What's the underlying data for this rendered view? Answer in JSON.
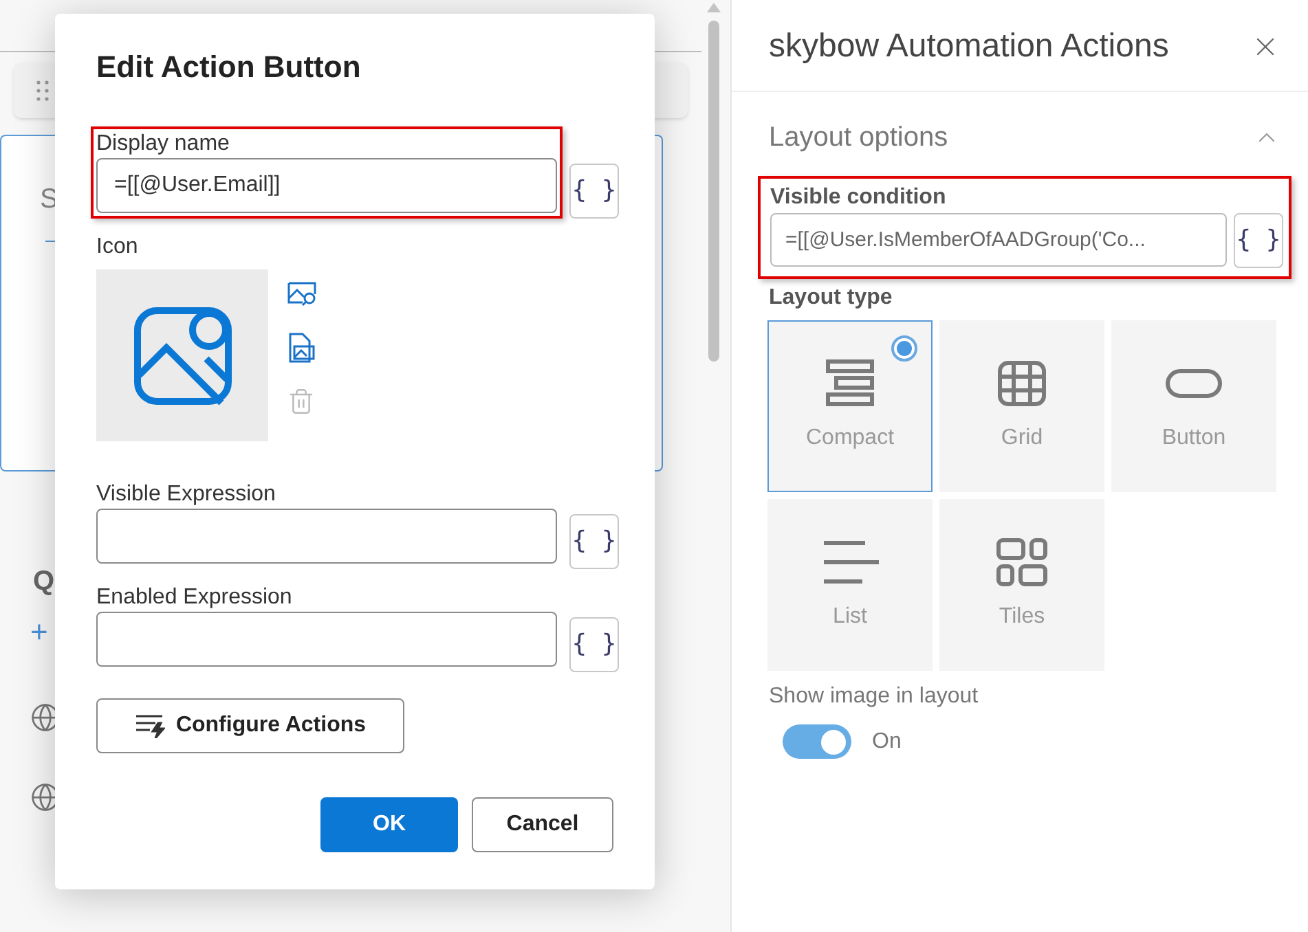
{
  "background": {
    "card_letter": "S",
    "section_letter": "Q",
    "add_sign": "+"
  },
  "dialog": {
    "title": "Edit Action Button",
    "fields": [
      {
        "kind": "text",
        "label": "Display name",
        "value": "=[[@User.Email]]",
        "highlighted": true,
        "expr_button": "{ }"
      },
      {
        "kind": "icon",
        "label": "Icon"
      },
      {
        "kind": "text",
        "label": "Visible Expression",
        "highlighted": false,
        "expr_button": "{ }"
      },
      {
        "kind": "text",
        "label": "Enabled Expression",
        "highlighted": false,
        "expr_button": "{ }"
      }
    ],
    "configure_button": "Configure Actions",
    "ok_button": "OK",
    "cancel_button": "Cancel"
  },
  "panel": {
    "title": "skybow Automation Actions",
    "section": {
      "title": "Layout options",
      "expanded": true
    },
    "visible_condition": {
      "label": "Visible condition",
      "value": "=[[@User.IsMemberOfAADGroup('Co...",
      "highlighted": true,
      "expr_button": "{ }"
    },
    "layout_type": {
      "label": "Layout type",
      "options": [
        {
          "kind": "compact",
          "label": "Compact",
          "selected": true
        },
        {
          "kind": "grid",
          "label": "Grid",
          "selected": false
        },
        {
          "kind": "button",
          "label": "Button",
          "selected": false
        },
        {
          "kind": "list",
          "label": "List",
          "selected": false
        },
        {
          "kind": "tiles",
          "label": "Tiles",
          "selected": false
        }
      ]
    },
    "show_image": {
      "label": "Show image in layout",
      "on": true,
      "state_text": "On"
    }
  }
}
